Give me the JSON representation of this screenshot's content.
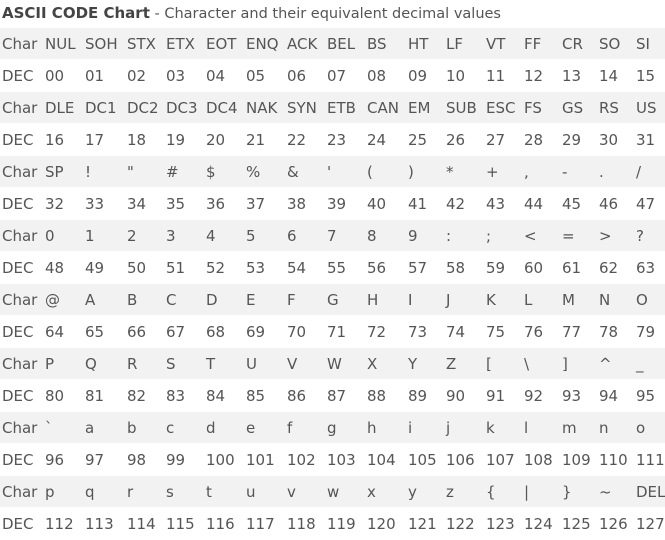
{
  "title": {
    "bold": "ASCII CODE Chart",
    "rest": " - Character and their equivalent decimal values"
  },
  "row_labels": {
    "char": "Char",
    "dec": "DEC"
  },
  "groups": [
    {
      "chars": [
        "NUL",
        "SOH",
        "STX",
        "ETX",
        "EOT",
        "ENQ",
        "ACK",
        "BEL",
        "BS",
        "HT",
        "LF",
        "VT",
        "FF",
        "CR",
        "SO",
        "SI"
      ],
      "decs": [
        "00",
        "01",
        "02",
        "03",
        "04",
        "05",
        "06",
        "07",
        "08",
        "09",
        "10",
        "11",
        "12",
        "13",
        "14",
        "15"
      ]
    },
    {
      "chars": [
        "DLE",
        "DC1",
        "DC2",
        "DC3",
        "DC4",
        "NAK",
        "SYN",
        "ETB",
        "CAN",
        "EM",
        "SUB",
        "ESC",
        "FS",
        "GS",
        "RS",
        "US"
      ],
      "decs": [
        "16",
        "17",
        "18",
        "19",
        "20",
        "21",
        "22",
        "23",
        "24",
        "25",
        "26",
        "27",
        "28",
        "29",
        "30",
        "31"
      ]
    },
    {
      "chars": [
        "SP",
        "!",
        "\"",
        "#",
        "$",
        "%",
        "&",
        "'",
        "(",
        ")",
        "*",
        "+",
        ",",
        "-",
        ".",
        "/"
      ],
      "decs": [
        "32",
        "33",
        "34",
        "35",
        "36",
        "37",
        "38",
        "39",
        "40",
        "41",
        "42",
        "43",
        "44",
        "45",
        "46",
        "47"
      ]
    },
    {
      "chars": [
        "0",
        "1",
        "2",
        "3",
        "4",
        "5",
        "6",
        "7",
        "8",
        "9",
        ":",
        ";",
        "<",
        "=",
        ">",
        "?"
      ],
      "decs": [
        "48",
        "49",
        "50",
        "51",
        "52",
        "53",
        "54",
        "55",
        "56",
        "57",
        "58",
        "59",
        "60",
        "61",
        "62",
        "63"
      ]
    },
    {
      "chars": [
        "@",
        "A",
        "B",
        "C",
        "D",
        "E",
        "F",
        "G",
        "H",
        "I",
        "J",
        "K",
        "L",
        "M",
        "N",
        "O"
      ],
      "decs": [
        "64",
        "65",
        "66",
        "67",
        "68",
        "69",
        "70",
        "71",
        "72",
        "73",
        "74",
        "75",
        "76",
        "77",
        "78",
        "79"
      ]
    },
    {
      "chars": [
        "P",
        "Q",
        "R",
        "S",
        "T",
        "U",
        "V",
        "W",
        "X",
        "Y",
        "Z",
        "[",
        "\\",
        "]",
        "^",
        "_"
      ],
      "decs": [
        "80",
        "81",
        "82",
        "83",
        "84",
        "85",
        "86",
        "87",
        "88",
        "89",
        "90",
        "91",
        "92",
        "93",
        "94",
        "95"
      ]
    },
    {
      "chars": [
        "`",
        "a",
        "b",
        "c",
        "d",
        "e",
        "f",
        "g",
        "h",
        "i",
        "j",
        "k",
        "l",
        "m",
        "n",
        "o"
      ],
      "decs": [
        "96",
        "97",
        "98",
        "99",
        "100",
        "101",
        "102",
        "103",
        "104",
        "105",
        "106",
        "107",
        "108",
        "109",
        "110",
        "111"
      ]
    },
    {
      "chars": [
        "p",
        "q",
        "r",
        "s",
        "t",
        "u",
        "v",
        "w",
        "x",
        "y",
        "z",
        "{",
        "|",
        "}",
        "~",
        "DEL"
      ],
      "decs": [
        "112",
        "113",
        "114",
        "115",
        "116",
        "117",
        "118",
        "119",
        "120",
        "121",
        "122",
        "123",
        "124",
        "125",
        "126",
        "127"
      ]
    }
  ]
}
